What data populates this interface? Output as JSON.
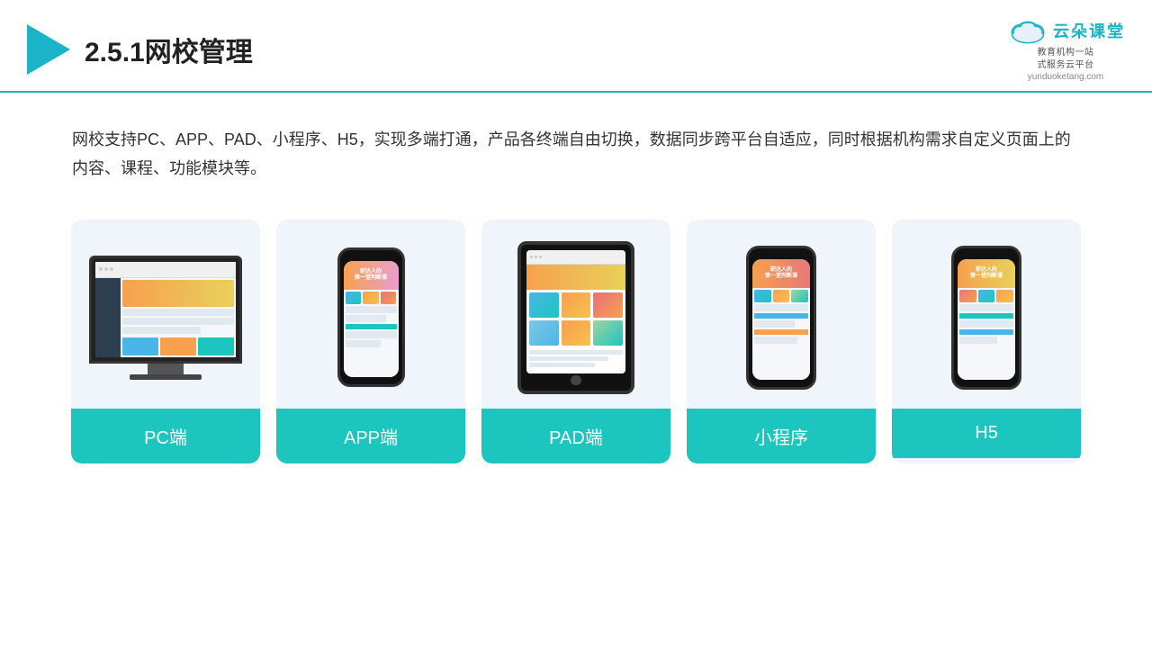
{
  "header": {
    "title": "2.5.1网校管理",
    "logo_text": "云朵课堂",
    "logo_url": "yunduoketang.com",
    "logo_sub": "教育机构一站\n式服务云平台"
  },
  "description": {
    "text": "网校支持PC、APP、PAD、小程序、H5，实现多端打通，产品各终端自由切换，数据同步跨平台自适应，同时根据机构需求自定义页面上的内容、课程、功能模块等。"
  },
  "cards": [
    {
      "id": "pc",
      "label": "PC端"
    },
    {
      "id": "app",
      "label": "APP端"
    },
    {
      "id": "pad",
      "label": "PAD端"
    },
    {
      "id": "miniprogram",
      "label": "小程序"
    },
    {
      "id": "h5",
      "label": "H5"
    }
  ],
  "colors": {
    "teal": "#1cc5be",
    "accent_blue": "#1ab3c8",
    "bg_card": "#f0f5fb"
  }
}
